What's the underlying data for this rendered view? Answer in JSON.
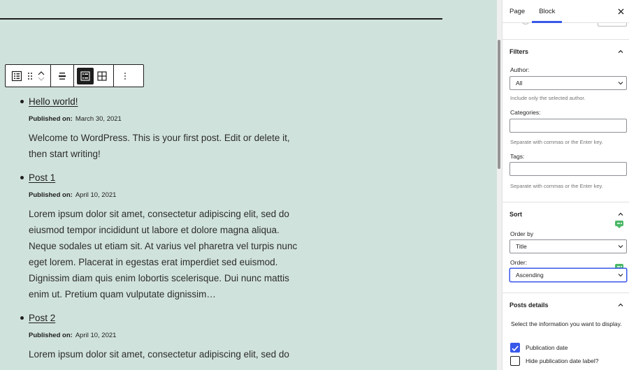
{
  "toolbar": {
    "icons": [
      "list-view-icon",
      "drag-handle-icon",
      "move-up-icon",
      "move-down-icon",
      "align-icon",
      "list-layout-icon",
      "grid-layout-icon",
      "more-options-icon"
    ]
  },
  "posts": [
    {
      "title": "Hello world!",
      "published_label": "Published on:",
      "date": "March 30, 2021",
      "excerpt": "Welcome to WordPress. This is your first post. Edit or delete it, then start writing!"
    },
    {
      "title": "Post 1",
      "published_label": "Published on:",
      "date": "April 10, 2021",
      "excerpt": "Lorem ipsum dolor sit amet, consectetur adipiscing elit, sed do eiusmod tempor incididunt ut labore et dolore magna aliqua. Neque sodales ut etiam sit. At varius vel pharetra vel turpis nunc eget lorem. Placerat in egestas erat imperdiet sed euismod. Dignissim diam quis enim lobortis scelerisque. Dui nunc mattis enim ut. Pretium quam vulputate dignissim…"
    },
    {
      "title": "Post 2",
      "published_label": "Published on:",
      "date": "April 10, 2021",
      "excerpt": "Lorem ipsum dolor sit amet, consectetur adipiscing elit, sed do"
    }
  ],
  "sidebar": {
    "tabs": [
      {
        "label": "Page",
        "active": false
      },
      {
        "label": "Block",
        "active": true
      }
    ],
    "close_icon": "close-icon",
    "filters": {
      "title": "Filters",
      "author_label": "Author:",
      "author_value": "All",
      "author_help": "Include only the selected author.",
      "categories_label": "Categories:",
      "categories_value": "",
      "categories_help": "Separate with commas or the Enter key.",
      "tags_label": "Tags:",
      "tags_value": "",
      "tags_help": "Separate with commas or the Enter key."
    },
    "sort": {
      "title": "Sort",
      "order_by_label": "Order by",
      "order_by_value": "Title",
      "order_label": "Order:",
      "order_value": "Ascending"
    },
    "posts_details": {
      "title": "Posts details",
      "description": "Select the information you want to display.",
      "publication_date_label": "Publication date",
      "publication_date_checked": true,
      "hide_label_label": "Hide publication date label?",
      "hide_label_checked": false
    }
  },
  "colors": {
    "canvas_bg": "#d0e2dc",
    "accent": "#3858e9",
    "bubble": "#4ab866"
  }
}
